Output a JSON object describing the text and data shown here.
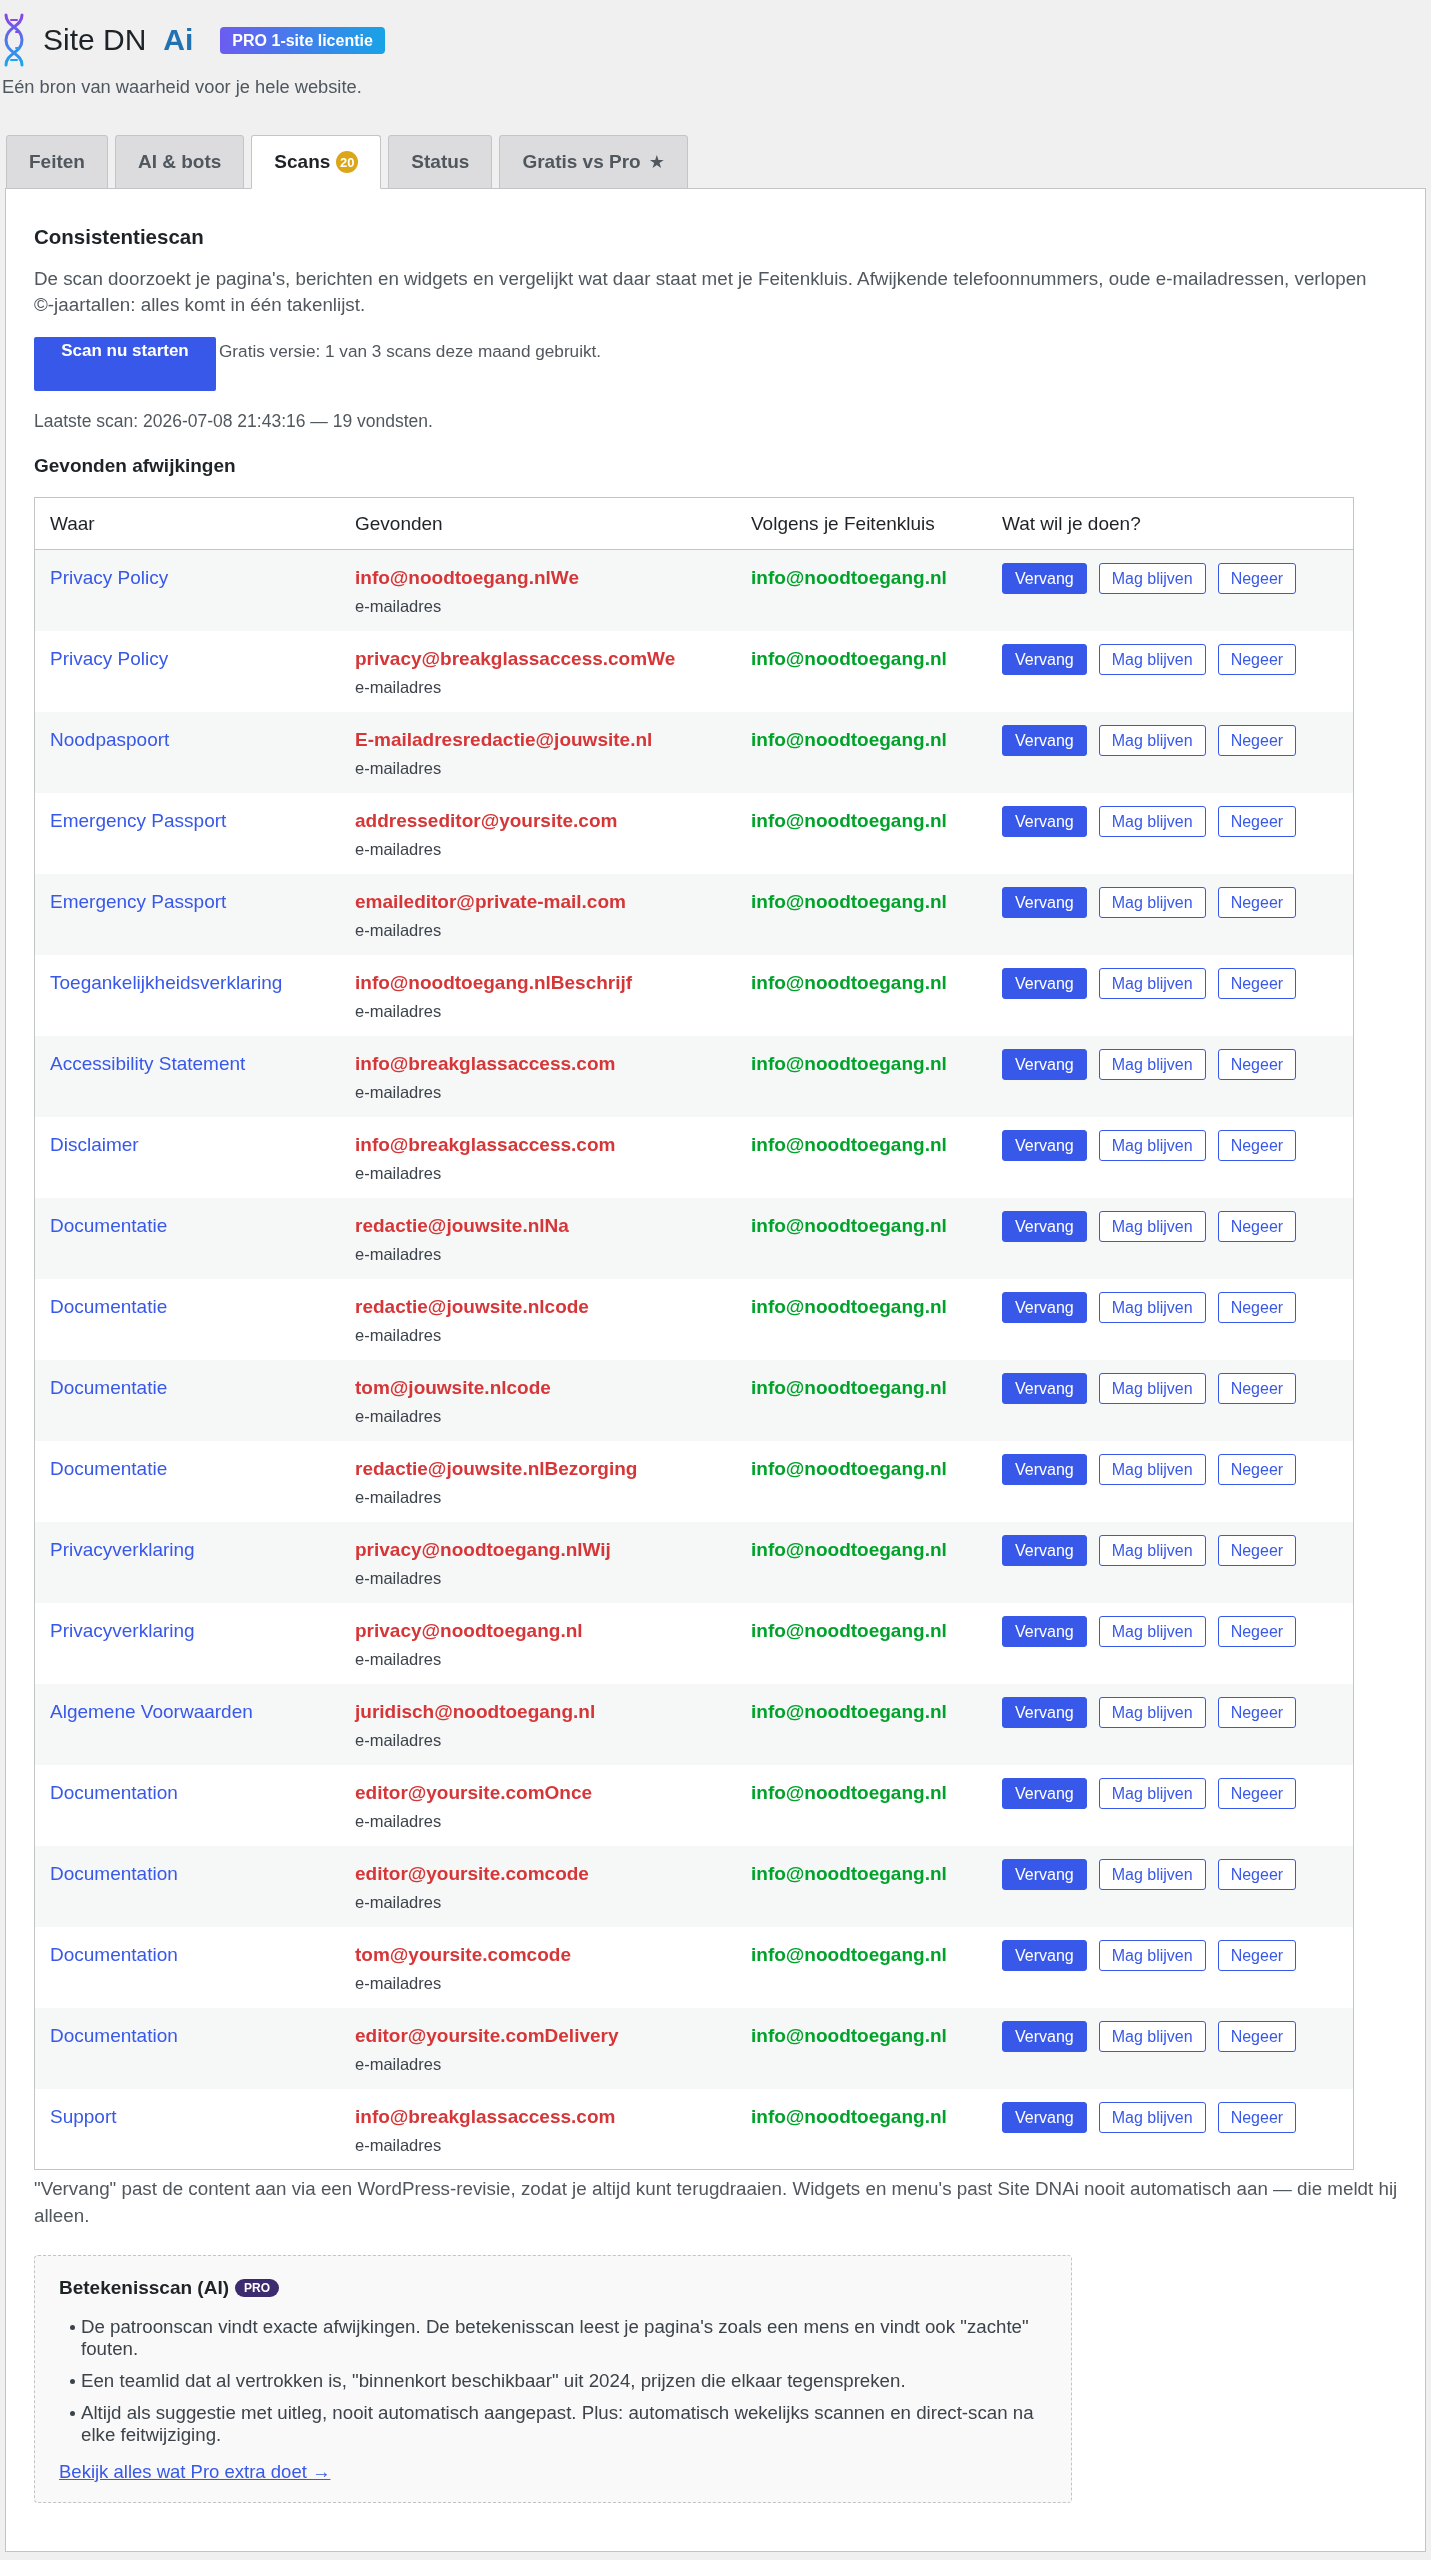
{
  "header": {
    "title": "Site DN",
    "title_suffix": "Ai",
    "license_badge": "PRO 1-site licentie",
    "tagline": "Eén bron van waarheid voor je hele website."
  },
  "tabs": [
    {
      "label": "Feiten",
      "selected": false
    },
    {
      "label": "AI & bots",
      "selected": false
    },
    {
      "label": "Scans",
      "selected": true,
      "badge": "20"
    },
    {
      "label": "Status",
      "selected": false
    },
    {
      "label": "Gratis vs Pro",
      "selected": false,
      "icon": "★"
    }
  ],
  "scan": {
    "title": "Consistentiescan",
    "description": "De scan doorzoekt je pagina's, berichten en widgets en vergelijkt wat daar staat met je Feitenkluis. Afwijkende telefoonnummers, oude e-mailadressen, verlopen ©-jaartallen: alles komt in één takenlijst.",
    "button": "Scan nu starten",
    "usage_note": "Gratis versie: 1 van 3 scans deze maand gebruikt.",
    "last_scan": "Laatste scan: 2026-07-08 21:43:16 — 19 vondsten."
  },
  "findings": {
    "title": "Gevonden afwijkingen",
    "columns": [
      "Waar",
      "Gevonden",
      "Volgens je Feitenkluis",
      "Wat wil je doen?"
    ],
    "rows": [
      {
        "where": "Privacy Policy",
        "found": "info@noodtoegang.nlWe",
        "type": "e-mailadres",
        "expected": "info@noodtoegang.nl",
        "actions": [
          {
            "label": "Vervang",
            "kind": "replace"
          },
          {
            "label": "Mag blijven",
            "kind": "keep"
          },
          {
            "label": "Negeer",
            "kind": "ignore"
          }
        ]
      },
      {
        "where": "Privacy Policy",
        "found": "privacy@breakglassaccess.comWe",
        "type": "e-mailadres",
        "expected": "info@noodtoegang.nl",
        "actions": [
          {
            "label": "Vervang",
            "kind": "replace"
          },
          {
            "label": "Mag blijven",
            "kind": "keep"
          },
          {
            "label": "Negeer",
            "kind": "ignore"
          }
        ]
      },
      {
        "where": "Noodpaspoort",
        "found": "E-mailadresredactie@jouwsite.nl",
        "type": "e-mailadres",
        "expected": "info@noodtoegang.nl",
        "actions": [
          {
            "label": "Vervang",
            "kind": "replace"
          },
          {
            "label": "Mag blijven",
            "kind": "keep"
          },
          {
            "label": "Negeer",
            "kind": "ignore"
          }
        ]
      },
      {
        "where": "Emergency Passport",
        "found": "addresseditor@yoursite.com",
        "type": "e-mailadres",
        "expected": "info@noodtoegang.nl",
        "actions": [
          {
            "label": "Vervang",
            "kind": "replace"
          },
          {
            "label": "Mag blijven",
            "kind": "keep"
          },
          {
            "label": "Negeer",
            "kind": "ignore"
          }
        ]
      },
      {
        "where": "Emergency Passport",
        "found": "emaileditor@private-mail.com",
        "type": "e-mailadres",
        "expected": "info@noodtoegang.nl",
        "actions": [
          {
            "label": "Vervang",
            "kind": "replace"
          },
          {
            "label": "Mag blijven",
            "kind": "keep"
          },
          {
            "label": "Negeer",
            "kind": "ignore"
          }
        ]
      },
      {
        "where": "Toegankelijkheidsverklaring",
        "found": "info@noodtoegang.nlBeschrijf",
        "type": "e-mailadres",
        "expected": "info@noodtoegang.nl",
        "actions": [
          {
            "label": "Vervang",
            "kind": "replace"
          },
          {
            "label": "Mag blijven",
            "kind": "keep"
          },
          {
            "label": "Negeer",
            "kind": "ignore"
          }
        ]
      },
      {
        "where": "Accessibility Statement",
        "found": "info@breakglassaccess.com",
        "type": "e-mailadres",
        "expected": "info@noodtoegang.nl",
        "actions": [
          {
            "label": "Vervang",
            "kind": "replace"
          },
          {
            "label": "Mag blijven",
            "kind": "keep"
          },
          {
            "label": "Negeer",
            "kind": "ignore"
          }
        ]
      },
      {
        "where": "Disclaimer",
        "found": "info@breakglassaccess.com",
        "type": "e-mailadres",
        "expected": "info@noodtoegang.nl",
        "actions": [
          {
            "label": "Vervang",
            "kind": "replace"
          },
          {
            "label": "Mag blijven",
            "kind": "keep"
          },
          {
            "label": "Negeer",
            "kind": "ignore"
          }
        ]
      },
      {
        "where": "Documentatie",
        "found": "redactie@jouwsite.nlNa",
        "type": "e-mailadres",
        "expected": "info@noodtoegang.nl",
        "actions": [
          {
            "label": "Vervang",
            "kind": "replace"
          },
          {
            "label": "Mag blijven",
            "kind": "keep"
          },
          {
            "label": "Negeer",
            "kind": "ignore"
          }
        ]
      },
      {
        "where": "Documentatie",
        "found": "redactie@jouwsite.nlcode",
        "type": "e-mailadres",
        "expected": "info@noodtoegang.nl",
        "actions": [
          {
            "label": "Vervang",
            "kind": "replace"
          },
          {
            "label": "Mag blijven",
            "kind": "keep"
          },
          {
            "label": "Negeer",
            "kind": "ignore"
          }
        ]
      },
      {
        "where": "Documentatie",
        "found": "tom@jouwsite.nlcode",
        "type": "e-mailadres",
        "expected": "info@noodtoegang.nl",
        "actions": [
          {
            "label": "Vervang",
            "kind": "replace"
          },
          {
            "label": "Mag blijven",
            "kind": "keep"
          },
          {
            "label": "Negeer",
            "kind": "ignore"
          }
        ]
      },
      {
        "where": "Documentatie",
        "found": "redactie@jouwsite.nlBezorging",
        "type": "e-mailadres",
        "expected": "info@noodtoegang.nl",
        "actions": [
          {
            "label": "Vervang",
            "kind": "replace"
          },
          {
            "label": "Mag blijven",
            "kind": "keep"
          },
          {
            "label": "Negeer",
            "kind": "ignore"
          }
        ]
      },
      {
        "where": "Privacyverklaring",
        "found": "privacy@noodtoegang.nlWij",
        "type": "e-mailadres",
        "expected": "info@noodtoegang.nl",
        "actions": [
          {
            "label": "Vervang",
            "kind": "replace"
          },
          {
            "label": "Mag blijven",
            "kind": "keep"
          },
          {
            "label": "Negeer",
            "kind": "ignore"
          }
        ]
      },
      {
        "where": "Privacyverklaring",
        "found": "privacy@noodtoegang.nl",
        "type": "e-mailadres",
        "expected": "info@noodtoegang.nl",
        "actions": [
          {
            "label": "Vervang",
            "kind": "replace"
          },
          {
            "label": "Mag blijven",
            "kind": "keep"
          },
          {
            "label": "Negeer",
            "kind": "ignore"
          }
        ]
      },
      {
        "where": "Algemene Voorwaarden",
        "found": "juridisch@noodtoegang.nl",
        "type": "e-mailadres",
        "expected": "info@noodtoegang.nl",
        "actions": [
          {
            "label": "Vervang",
            "kind": "replace"
          },
          {
            "label": "Mag blijven",
            "kind": "keep"
          },
          {
            "label": "Negeer",
            "kind": "ignore"
          }
        ]
      },
      {
        "where": "Documentation",
        "found": "editor@yoursite.comOnce",
        "type": "e-mailadres",
        "expected": "info@noodtoegang.nl",
        "actions": [
          {
            "label": "Vervang",
            "kind": "replace"
          },
          {
            "label": "Mag blijven",
            "kind": "keep"
          },
          {
            "label": "Negeer",
            "kind": "ignore"
          }
        ]
      },
      {
        "where": "Documentation",
        "found": "editor@yoursite.comcode",
        "type": "e-mailadres",
        "expected": "info@noodtoegang.nl",
        "actions": [
          {
            "label": "Vervang",
            "kind": "replace"
          },
          {
            "label": "Mag blijven",
            "kind": "keep"
          },
          {
            "label": "Negeer",
            "kind": "ignore"
          }
        ]
      },
      {
        "where": "Documentation",
        "found": "tom@yoursite.comcode",
        "type": "e-mailadres",
        "expected": "info@noodtoegang.nl",
        "actions": [
          {
            "label": "Vervang",
            "kind": "replace"
          },
          {
            "label": "Mag blijven",
            "kind": "keep"
          },
          {
            "label": "Negeer",
            "kind": "ignore"
          }
        ]
      },
      {
        "where": "Documentation",
        "found": "editor@yoursite.comDelivery",
        "type": "e-mailadres",
        "expected": "info@noodtoegang.nl",
        "actions": [
          {
            "label": "Vervang",
            "kind": "replace"
          },
          {
            "label": "Mag blijven",
            "kind": "keep"
          },
          {
            "label": "Negeer",
            "kind": "ignore"
          }
        ]
      },
      {
        "where": "Support",
        "found": "info@breakglassaccess.com",
        "type": "e-mailadres",
        "expected": "info@noodtoegang.nl",
        "actions": [
          {
            "label": "Vervang",
            "kind": "replace"
          },
          {
            "label": "Mag blijven",
            "kind": "keep"
          },
          {
            "label": "Negeer",
            "kind": "ignore"
          }
        ]
      }
    ]
  },
  "footnote": "\"Vervang\" past de content aan via een WordPress-revisie, zodat je altijd kunt terugdraaien. Widgets en menu's past Site DNAi nooit automatisch aan — die meldt hij alleen.",
  "pro_box": {
    "title": "Betekenisscan (AI)",
    "badge": "PRO",
    "bullets": [
      "De patroonscan vindt exacte afwijkingen. De betekenisscan leest je pagina's zoals een mens en vindt ook \"zachte\" fouten.",
      "Een teamlid dat al vertrokken is, \"binnenkort beschikbaar\" uit 2024, prijzen die elkaar tegenspreken.",
      "Altijd als suggestie met uitleg, nooit automatisch aangepast. Plus: automatisch wekelijks scannen en direct-scan na elke feitwijziging."
    ],
    "link": "Bekijk alles wat Pro extra doet →"
  }
}
